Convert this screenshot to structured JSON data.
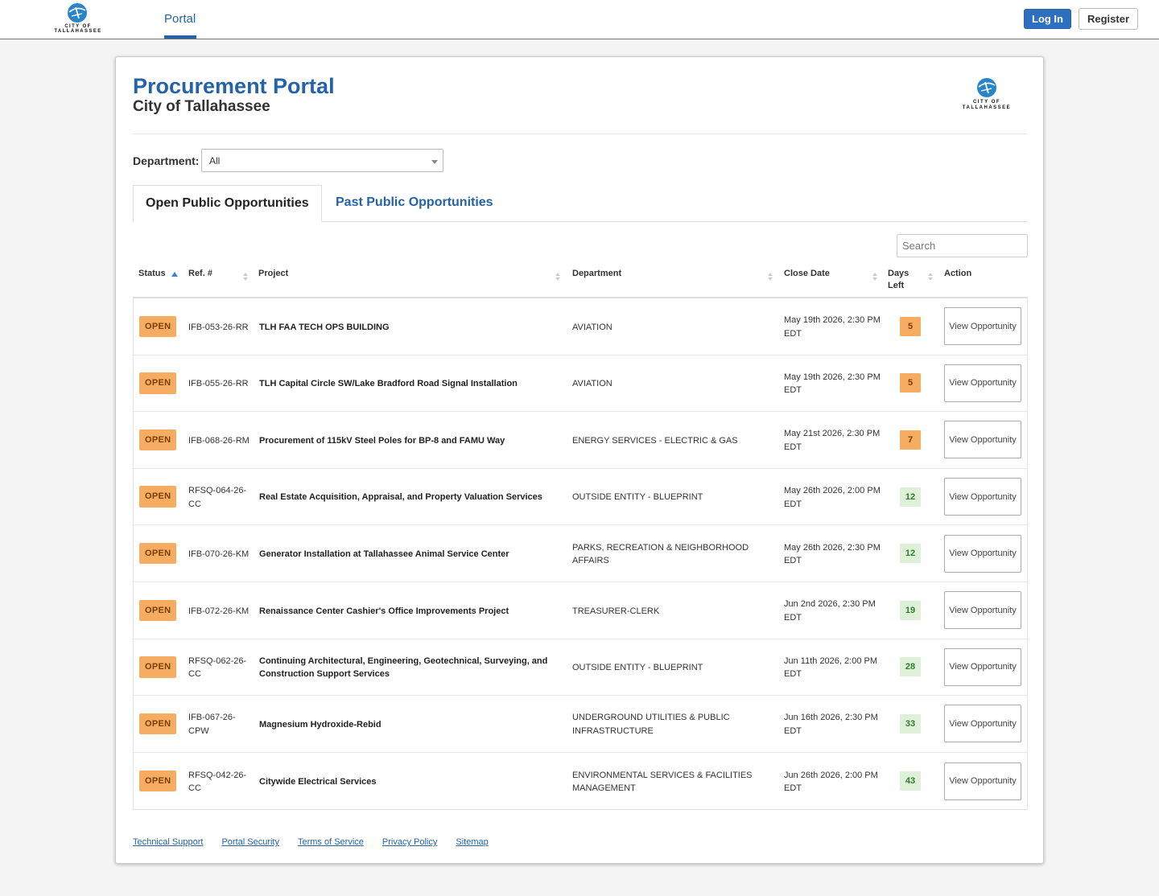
{
  "nav": {
    "logo_text": "CITY OF TALLAHASSEE",
    "tab_portal": "Portal",
    "login_label": "Log In",
    "register_label": "Register"
  },
  "header": {
    "title": "Procurement Portal",
    "subtitle": "City of Tallahassee"
  },
  "filter": {
    "department_label": "Department:",
    "department_value": "All"
  },
  "tabs": {
    "open": "Open Public Opportunities",
    "past": "Past Public Opportunities"
  },
  "search": {
    "placeholder": "Search"
  },
  "columns": {
    "status": "Status",
    "ref": "Ref. #",
    "project": "Project",
    "department": "Department",
    "close_date": "Close Date",
    "days_left": "Days Left",
    "action": "Action"
  },
  "rows": [
    {
      "status": "OPEN",
      "ref": "IFB-053-26-RR",
      "project": "TLH FAA TECH OPS BUILDING",
      "department": "AVIATION",
      "close": "May 19th 2026, 2:30 PM EDT",
      "days": "5",
      "days_level": "warn",
      "action": "View Opportunity"
    },
    {
      "status": "OPEN",
      "ref": "IFB-055-26-RR",
      "project": "TLH Capital Circle SW/Lake Bradford Road Signal Installation",
      "department": "AVIATION",
      "close": "May 19th 2026, 2:30 PM EDT",
      "days": "5",
      "days_level": "warn",
      "action": "View Opportunity"
    },
    {
      "status": "OPEN",
      "ref": "IFB-068-26-RM",
      "project": "Procurement of 115kV Steel Poles for BP-8 and FAMU Way",
      "department": "ENERGY SERVICES - ELECTRIC & GAS",
      "close": "May 21st 2026, 2:30 PM EDT",
      "days": "7",
      "days_level": "warn",
      "action": "View Opportunity"
    },
    {
      "status": "OPEN",
      "ref": "RFSQ-064-26-CC",
      "project": "Real Estate Acquisition, Appraisal, and Property Valuation Services",
      "department": "OUTSIDE ENTITY - BLUEPRINT",
      "close": "May 26th 2026, 2:00 PM EDT",
      "days": "12",
      "days_level": "ok",
      "action": "View Opportunity"
    },
    {
      "status": "OPEN",
      "ref": "IFB-070-26-KM",
      "project": "Generator Installation at Tallahassee Animal Service Center",
      "department": "PARKS, RECREATION & NEIGHBORHOOD AFFAIRS",
      "close": "May 26th 2026, 2:30 PM EDT",
      "days": "12",
      "days_level": "ok",
      "action": "View Opportunity"
    },
    {
      "status": "OPEN",
      "ref": "IFB-072-26-KM",
      "project": "Renaissance Center Cashier's Office Improvements Project",
      "department": "TREASURER-CLERK",
      "close": "Jun 2nd 2026, 2:30 PM EDT",
      "days": "19",
      "days_level": "ok",
      "action": "View Opportunity"
    },
    {
      "status": "OPEN",
      "ref": "RFSQ-062-26-CC",
      "project": "Continuing Architectural, Engineering, Geotechnical, Surveying, and Construction Support Services",
      "department": "OUTSIDE ENTITY - BLUEPRINT",
      "close": "Jun 11th 2026, 2:00 PM EDT",
      "days": "28",
      "days_level": "ok",
      "action": "View Opportunity"
    },
    {
      "status": "OPEN",
      "ref": "IFB-067-26-CPW",
      "project": "Magnesium Hydroxide-Rebid",
      "department": "UNDERGROUND UTILITIES & PUBLIC INFRASTRUCTURE",
      "close": "Jun 16th 2026, 2:30 PM EDT",
      "days": "33",
      "days_level": "ok",
      "action": "View Opportunity"
    },
    {
      "status": "OPEN",
      "ref": "RFSQ-042-26-CC",
      "project": "Citywide Electrical Services",
      "department": "ENVIRONMENTAL SERVICES & FACILITIES MANAGEMENT",
      "close": "Jun 26th 2026, 2:00 PM EDT",
      "days": "43",
      "days_level": "ok",
      "action": "View Opportunity"
    }
  ],
  "footer": {
    "links": [
      "Technical Support",
      "Portal Security",
      "Terms of Service",
      "Privacy Policy",
      "Sitemap"
    ]
  },
  "colors": {
    "brand_blue": "#2563a8",
    "open_badge": "#f6ad62",
    "days_ok_bg": "#dff0d8",
    "days_ok_text": "#2e7d32"
  }
}
